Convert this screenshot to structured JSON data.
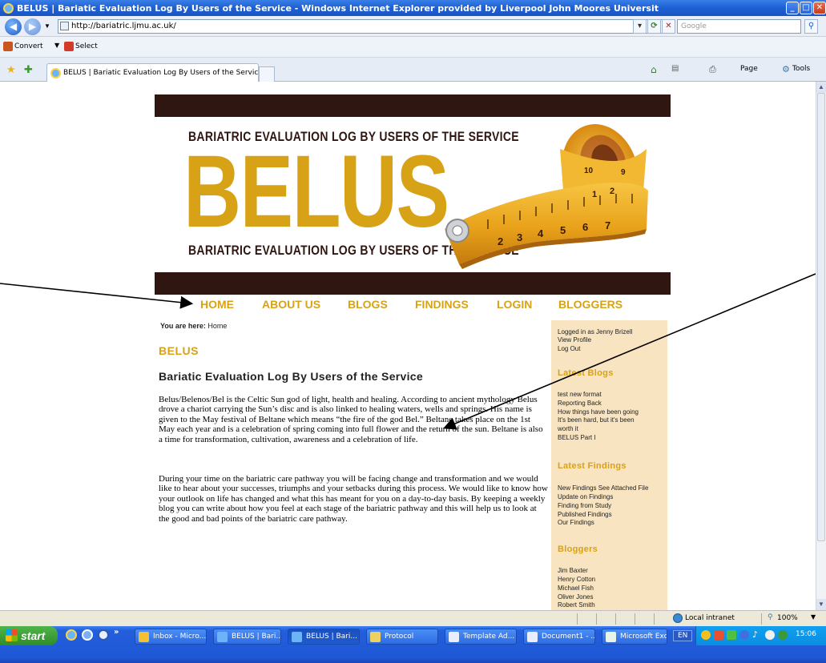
{
  "window": {
    "title": "BELUS | Bariatic Evaluation Log By Users of the Service - Windows Internet Explorer provided by Liverpool John Moores Universit",
    "address": "http://bariatric.ljmu.ac.uk/",
    "search_placeholder": "Google",
    "convert_label": "Convert",
    "select_label": "Select",
    "tab_title": "BELUS | Bariatic Evaluation Log By Users of the Service",
    "page_menu": "Page",
    "tools_menu": "Tools"
  },
  "banner": {
    "top_text": "BARIATRIC EVALUATION LOG BY USERS OF THE SERVICE",
    "big_text": "BELUS",
    "bottom_text": "BARIATRIC EVALUATION LOG BY USERS OF THE SERVICE"
  },
  "nav": [
    "HOME",
    "ABOUT US",
    "BLOGS",
    "FINDINGS",
    "LOGIN",
    "BLOGGERS"
  ],
  "breadcrumb": {
    "prefix": "You are here:",
    "current": "Home"
  },
  "main": {
    "heading": "BELUS",
    "subheading": "Bariatic Evaluation Log By Users of the Service",
    "para1": "Belus/Belenos/Bel is the Celtic Sun god of light, health and healing.  According to ancient mythology Belus drove a chariot carrying the Sun’s disc and is also linked to healing waters, wells and springs. His name is given to the May festival of Beltane which means “the fire of the god Bel.” Beltane takes place on the 1st May each year and is a celebration of spring coming into full flower and the return of the sun. Beltane is also a time for transformation, cultivation, awareness and a celebration of life.",
    "para2": "During your time on the bariatric care pathway you will be facing change and transformation and we would like to hear about your successes, triumphs and your setbacks during this process.  We would like to know how your outlook on life has changed and what this has meant for you on a day-to-day basis.  By keeping a weekly blog you can write about how you  feel at each stage of the bariatric pathway and this will help us to look at the good and bad points of the bariatric care pathway."
  },
  "sidebar": {
    "logged_in": "Logged in as Jenny Brizell",
    "view_profile": "View Profile",
    "log_out": "Log Out",
    "latest_blogs_heading": "Latest Blogs",
    "blogs": [
      "test new format",
      "Reporting Back",
      "How things have been going",
      "It's been hard, but it's been",
      "worth it",
      "BELUS Part I"
    ],
    "latest_findings_heading": "Latest Findings",
    "findings": [
      "New Findings See Attached File",
      "Update on Findings",
      "Finding from Study",
      "Published Findings",
      "Our Findings"
    ],
    "bloggers_heading": "Bloggers",
    "bloggers": [
      "Jim Baxter",
      "Henry Cotton",
      "Michael Fish",
      "Oliver Jones",
      "Robert Smith"
    ]
  },
  "statusbar": {
    "zone": "Local intranet",
    "zoom": "100%"
  },
  "taskbar": {
    "start": "start",
    "buttons": [
      "Inbox - Micro...",
      "BELUS | Bari...",
      "BELUS | Bari...",
      "Protocol",
      "Template Ad...",
      "Document1 - ...",
      "Microsoft Exc..."
    ],
    "lang": "EN",
    "time": "15:06"
  },
  "colors": {
    "gold": "#d8a216",
    "brown": "#301610",
    "sidebar_bg": "#f8e4c0"
  }
}
